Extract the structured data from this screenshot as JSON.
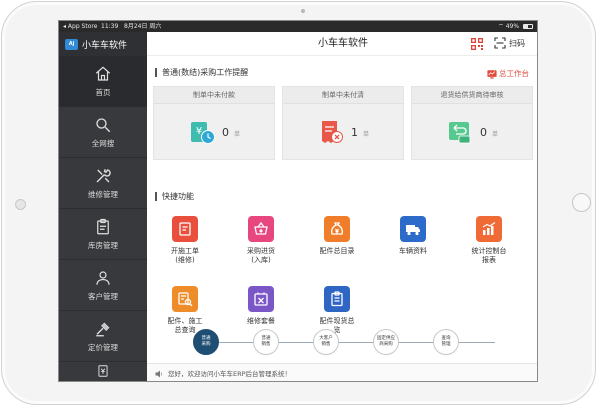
{
  "status_bar": {
    "carrier": "◂ App Store",
    "time": "11:39",
    "date": "8月24日 周六",
    "battery_pct": "49%",
    "battery_fill": 0.49
  },
  "app": {
    "brand": "小车车软件",
    "title": "小车车软件"
  },
  "sidebar": {
    "items": [
      {
        "label": "首页",
        "icon": "home-icon"
      },
      {
        "label": "全网搜",
        "icon": "search-icon"
      },
      {
        "label": "维修管理",
        "icon": "tools-icon"
      },
      {
        "label": "库房管理",
        "icon": "clipboard-icon"
      },
      {
        "label": "客户管理",
        "icon": "users-icon"
      },
      {
        "label": "定价管理",
        "icon": "gavel-icon"
      }
    ]
  },
  "toolbar": {
    "scan_label": "扫码",
    "dashboard_link": "总工作台"
  },
  "reminders": {
    "title": "普通(数结)采购工作提醒",
    "cards": [
      {
        "title": "制单中未付款",
        "value": "0",
        "unit": "单",
        "icon": "yen-clock-icon"
      },
      {
        "title": "制单中未付清",
        "value": "1",
        "unit": "单",
        "icon": "invoice-cancel-icon"
      },
      {
        "title": "退货给供货商待审核",
        "value": "0",
        "unit": "单",
        "icon": "return-goods-icon"
      }
    ]
  },
  "shortcuts": {
    "title": "快捷功能",
    "items": [
      {
        "label": "开施工单\n(维修)",
        "color": "#ea4f3d",
        "icon": "work-order-icon"
      },
      {
        "label": "采购进货\n(入库)",
        "color": "#e8467f",
        "icon": "basket-icon"
      },
      {
        "label": "配件总目录",
        "color": "#ef7d2a",
        "icon": "money-bag-icon"
      },
      {
        "label": "车辆资料",
        "color": "#2c6bc9",
        "icon": "truck-icon"
      },
      {
        "label": "统计控制台\n报表",
        "color": "#f06a35",
        "icon": "chart-icon"
      },
      {
        "label": "配件、施工\n总查询",
        "color": "#ef8c2a",
        "icon": "search-list-icon"
      },
      {
        "label": "维修套餐",
        "color": "#7a56c6",
        "icon": "package-icon"
      },
      {
        "label": "配件现货总\n览",
        "color": "#2f66c4",
        "icon": "inventory-icon"
      }
    ]
  },
  "tabs": [
    {
      "label": "普通\n采购",
      "active": true
    },
    {
      "label": "普通\n销售",
      "active": false
    },
    {
      "label": "大客户\n销售",
      "active": false
    },
    {
      "label": "固定供应\n商采购",
      "active": false
    },
    {
      "label": "查询\n管理",
      "active": false
    }
  ],
  "notice": {
    "text": "您好，欢迎访问小车车ERP后台管理系统！"
  }
}
